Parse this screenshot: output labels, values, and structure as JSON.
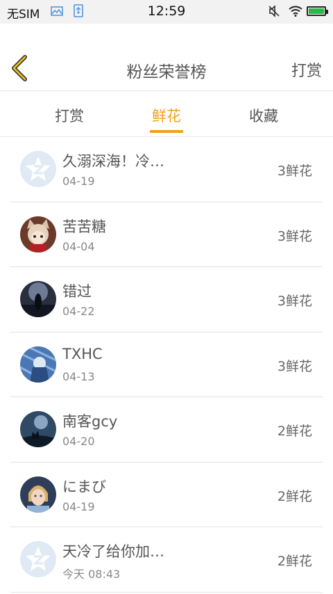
{
  "status_bar": {
    "carrier": "无SIM",
    "time": "12:59"
  },
  "header": {
    "title": "粉丝荣誉榜",
    "reward_link": "打赏"
  },
  "tabs": [
    {
      "label": "打赏"
    },
    {
      "label": "鲜花"
    },
    {
      "label": "收藏"
    }
  ],
  "active_tab": "鲜花",
  "colors": {
    "accent": "#f0a018",
    "battery": "#2db54a"
  },
  "list": [
    {
      "name": "久溺深海！冷…",
      "date": "04-19",
      "count": "3鲜花",
      "avatar": "default-qq-avatar"
    },
    {
      "name": "苦苦糖",
      "date": "04-04",
      "count": "3鲜花",
      "avatar": "anime-girl-avatar"
    },
    {
      "name": "错过",
      "date": "04-22",
      "count": "3鲜花",
      "avatar": "dark-figure-avatar"
    },
    {
      "name": "TXHC",
      "date": "04-13",
      "count": "3鲜花",
      "avatar": "blue-anime-avatar"
    },
    {
      "name": "南客gcy",
      "date": "04-20",
      "count": "2鲜花",
      "avatar": "wolf-night-avatar"
    },
    {
      "name": "にまび",
      "date": "04-19",
      "count": "2鲜花",
      "avatar": "cinderella-avatar"
    },
    {
      "name": "天冷了给你加…",
      "date": "今天 08:43",
      "count": "2鲜花",
      "avatar": "default-qq-avatar"
    }
  ]
}
